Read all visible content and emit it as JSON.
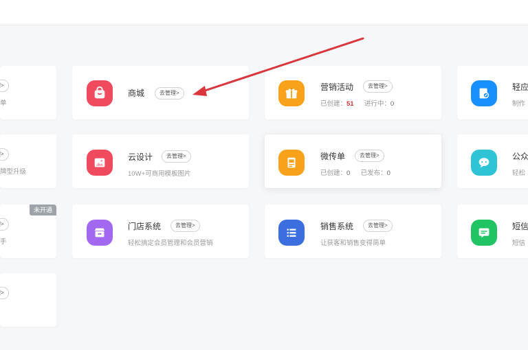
{
  "colors": {
    "accent_arrow": "#d9363e",
    "red_icon": "#f04a5e",
    "orange_icon": "#f7a21a",
    "blue_icon": "#1890ff",
    "purple_icon": "#a368f0",
    "navy_icon": "#3b6fe0",
    "teal_icon": "#2ec4d6",
    "green_icon": "#20c462"
  },
  "cards": {
    "left_r1": {
      "btn": "去管理>",
      "sub": "单"
    },
    "left_r2": {
      "btn": "去管理>",
      "sub": "牌型升级"
    },
    "left_r3": {
      "btn": "去管理>",
      "sub": "手",
      "badge": "未开通"
    },
    "left_r4": {
      "btn": "去管理>"
    },
    "mall": {
      "title": "商城",
      "btn": "去管理>",
      "icon": "shopping-bag-icon"
    },
    "marketing": {
      "title": "营销活动",
      "btn": "去管理>",
      "icon": "gift-icon",
      "created_label": "已创建：",
      "created_value": "51",
      "ongoing_label": "进行中：",
      "ongoing_value": "0"
    },
    "light_app": {
      "title": "轻应",
      "sub": "制作",
      "icon": "document-edit-icon"
    },
    "cloud_design": {
      "title": "云设计",
      "btn": "去管理>",
      "sub": "10W+可商用模板图片",
      "icon": "image-icon"
    },
    "micro_flyer": {
      "title": "微传单",
      "btn": "去管理>",
      "icon": "flyer-icon",
      "created_label": "已创建：",
      "created_value": "0",
      "published_label": "已发布：",
      "published_value": "0"
    },
    "official_account": {
      "title": "公众",
      "sub": "轻松",
      "icon": "chat-bubble-icon"
    },
    "store_system": {
      "title": "门店系统",
      "btn": "去管理>",
      "sub": "轻松搞定会员管理和会员营销",
      "icon": "store-icon"
    },
    "sales_system": {
      "title": "销售系统",
      "btn": "去管理>",
      "sub": "让获客和销售变得简单",
      "icon": "list-icon"
    },
    "sms": {
      "title": "短信",
      "sub": "短信",
      "icon": "message-icon"
    }
  }
}
